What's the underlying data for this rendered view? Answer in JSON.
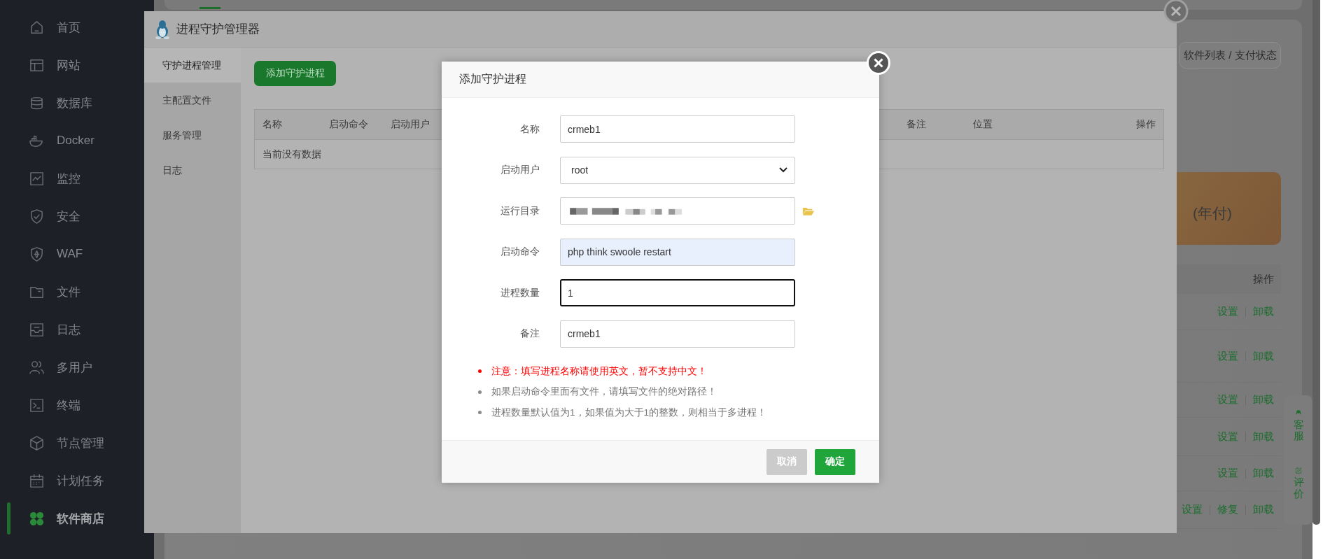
{
  "sidebar": {
    "items": [
      {
        "label": "首页",
        "selected": false
      },
      {
        "label": "网站",
        "selected": false
      },
      {
        "label": "数据库",
        "selected": false
      },
      {
        "label": "Docker",
        "selected": false
      },
      {
        "label": "监控",
        "selected": false
      },
      {
        "label": "安全",
        "selected": false
      },
      {
        "label": "WAF",
        "selected": false
      },
      {
        "label": "文件",
        "selected": false
      },
      {
        "label": "日志",
        "selected": false
      },
      {
        "label": "多用户",
        "selected": false
      },
      {
        "label": "终端",
        "selected": false
      },
      {
        "label": "节点管理",
        "selected": false
      },
      {
        "label": "计划任务",
        "selected": false
      },
      {
        "label": "软件商店",
        "selected": true
      }
    ]
  },
  "store_panel": {
    "refresh_button": "软件列表 / 支付状态",
    "banner_text": "(年付)",
    "table": {
      "columns": [
        "操作"
      ],
      "rows": [
        {
          "actions": [
            "设置",
            "卸载"
          ]
        },
        {
          "actions": [
            "设置",
            "卸载"
          ]
        },
        {
          "actions": [
            "设置",
            "卸载"
          ]
        },
        {
          "actions": [
            "设置",
            "卸载"
          ]
        },
        {
          "actions": [
            "设置",
            "卸载"
          ]
        },
        {
          "actions": [
            "设置",
            "修复",
            "卸载"
          ]
        }
      ]
    }
  },
  "support_widget": {
    "buttons": [
      "客服",
      "评价"
    ]
  },
  "manager_window": {
    "title": "进程守护管理器",
    "nav": [
      {
        "label": "守护进程管理",
        "selected": true
      },
      {
        "label": "主配置文件",
        "selected": false
      },
      {
        "label": "服务管理",
        "selected": false
      },
      {
        "label": "日志",
        "selected": false
      }
    ],
    "add_button": "添加守护进程",
    "table": {
      "columns": [
        "名称",
        "启动命令",
        "启动用户",
        "备注",
        "位置",
        "操作"
      ],
      "empty_text": "当前没有数据"
    }
  },
  "dialog": {
    "title": "添加守护进程",
    "fields": [
      {
        "label": "名称",
        "kind": "text",
        "value": "crmeb1",
        "focused": false,
        "autofilled": false
      },
      {
        "label": "启动用户",
        "kind": "select",
        "value": "root",
        "focused": false,
        "autofilled": false
      },
      {
        "label": "运行目录",
        "kind": "path",
        "focused": false,
        "autofilled": false
      },
      {
        "label": "启动命令",
        "kind": "text",
        "value": "php think swoole restart",
        "focused": false,
        "autofilled": true
      },
      {
        "label": "进程数量",
        "kind": "text",
        "value": "1",
        "focused": true,
        "autofilled": false
      },
      {
        "label": "备注",
        "kind": "text",
        "value": "crmeb1",
        "focused": false,
        "autofilled": false
      }
    ],
    "notes": [
      {
        "text": "注意：填写进程名称请使用英文，暂不支持中文！",
        "warning": true
      },
      {
        "text": "如果启动命令里面有文件，请填写文件的绝对路径！",
        "warning": false
      },
      {
        "text": "进程数量默认值为1，如果值为大于1的整数，则相当于多进程！",
        "warning": false
      }
    ],
    "buttons": [
      {
        "label": "取消",
        "kind": "cancel"
      },
      {
        "label": "确定",
        "kind": "confirm"
      }
    ]
  }
}
